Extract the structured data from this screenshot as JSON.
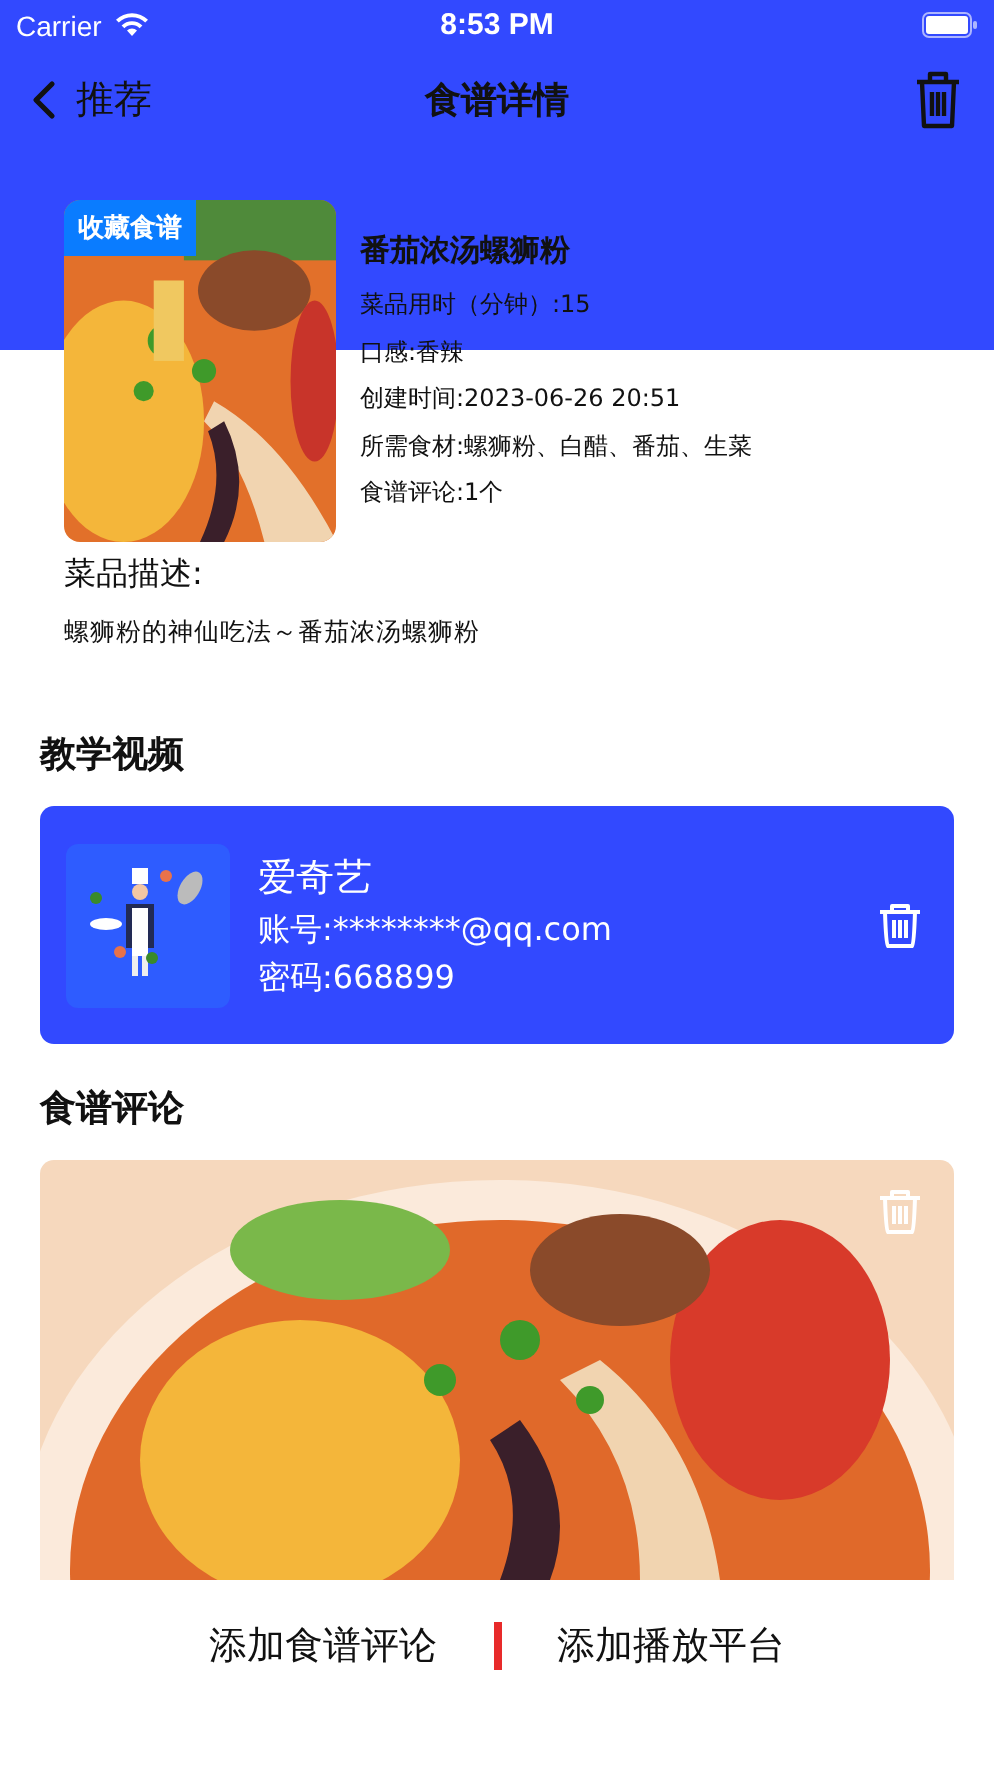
{
  "status_bar": {
    "carrier": "Carrier",
    "time": "8:53 PM"
  },
  "nav": {
    "back_label": "推荐",
    "title": "食谱详情"
  },
  "recipe": {
    "badge": "收藏食谱",
    "name": "番茄浓汤螺狮粉",
    "details": [
      "菜品用时（分钟）:15",
      "口感:香辣",
      "创建时间:2023-06-26 20:51",
      "所需食材:螺狮粉、白醋、番茄、生菜",
      "食谱评论:1个"
    ],
    "description_label": "菜品描述:",
    "description": "螺狮粉的神仙吃法～番茄浓汤螺狮粉"
  },
  "video_section": {
    "title": "教学视频",
    "platforms": [
      {
        "name": "爱奇艺",
        "account": "账号:********@qq.com",
        "password": "密码:668899"
      }
    ]
  },
  "comment_section": {
    "title": "食谱评论"
  },
  "bottom_bar": {
    "buttons": [
      "添加食谱评论",
      "添加播放平台"
    ]
  }
}
